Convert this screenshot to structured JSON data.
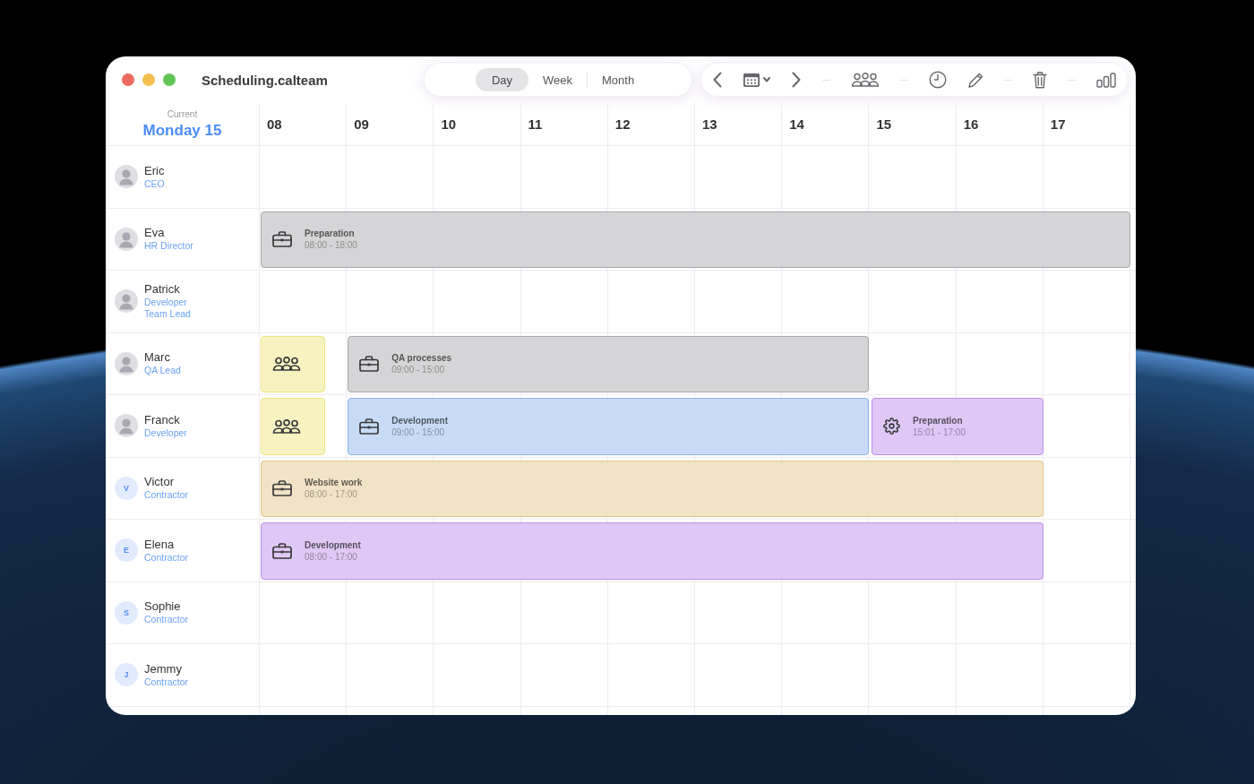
{
  "window": {
    "title": "Scheduling.calteam"
  },
  "view_tabs": [
    {
      "label": "Day",
      "selected": true
    },
    {
      "label": "Week",
      "selected": false
    },
    {
      "label": "Month",
      "selected": false
    }
  ],
  "header": {
    "caption": "Current",
    "date": "Monday 15",
    "hours": [
      "08",
      "09",
      "10",
      "11",
      "12",
      "13",
      "14",
      "15",
      "16",
      "17"
    ]
  },
  "people": [
    {
      "name": "Eric",
      "roles": [
        "CEO"
      ],
      "avatar": {
        "kind": "photo"
      }
    },
    {
      "name": "Eva",
      "roles": [
        "HR Director"
      ],
      "avatar": {
        "kind": "photo"
      },
      "events": [
        {
          "kind": "task",
          "title": "Preparation",
          "time": "08:00 - 18:00",
          "color": "#d5d5d7"
        }
      ]
    },
    {
      "name": "Patrick",
      "roles": [
        "Developer",
        "Team Lead"
      ],
      "avatar": {
        "kind": "photo"
      }
    },
    {
      "name": "Marc",
      "roles": [
        "QA Lead"
      ],
      "avatar": {
        "kind": "photo"
      },
      "events": [
        {
          "kind": "meeting",
          "color": "#f6f3c1"
        },
        {
          "kind": "task",
          "title": "QA processes",
          "time": "09:00 - 15:00",
          "color": "#d5d5d7"
        }
      ]
    },
    {
      "name": "Franck",
      "roles": [
        "Developer"
      ],
      "avatar": {
        "kind": "photo"
      },
      "events": [
        {
          "kind": "meeting",
          "color": "#f6f3c1"
        },
        {
          "kind": "task",
          "title": "Development",
          "time": "09:00 - 15:00",
          "color": "#c8dbf6"
        },
        {
          "kind": "setup",
          "title": "Preparation",
          "time": "15:01 - 17:00",
          "color": "#dfc8f5"
        }
      ]
    },
    {
      "name": "Victor",
      "roles": [
        "Contractor"
      ],
      "avatar": {
        "kind": "initial",
        "text": "V"
      },
      "events": [
        {
          "kind": "task",
          "title": "Website work",
          "time": "08:00 - 17:00",
          "color": "#f2e3c6"
        }
      ]
    },
    {
      "name": "Elena",
      "roles": [
        "Contractor"
      ],
      "avatar": {
        "kind": "initial",
        "text": "E"
      },
      "events": [
        {
          "kind": "task",
          "title": "Development",
          "time": "08:00 - 17:00",
          "color": "#dfc8f5"
        }
      ]
    },
    {
      "name": "Sophie",
      "roles": [
        "Contractor"
      ],
      "avatar": {
        "kind": "initial",
        "text": "S"
      }
    },
    {
      "name": "Jemmy",
      "roles": [
        "Contractor"
      ],
      "avatar": {
        "kind": "initial",
        "text": "J"
      }
    }
  ]
}
